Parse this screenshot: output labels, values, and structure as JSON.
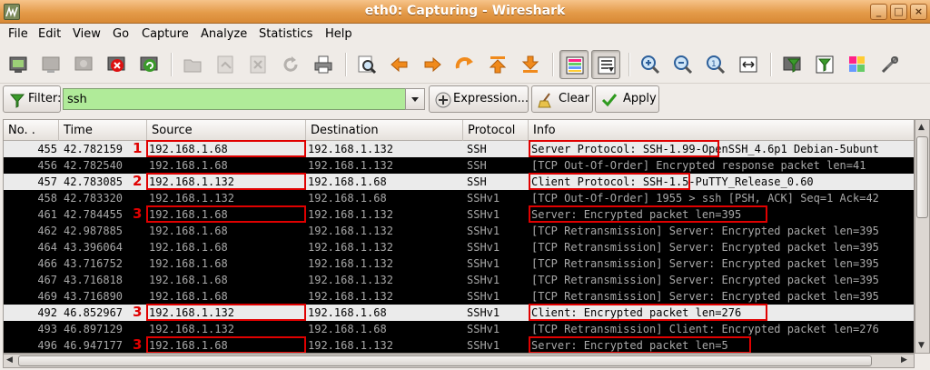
{
  "window": {
    "title": "eth0: Capturing - Wireshark",
    "minimize": "_",
    "maximize": "□",
    "close": "×"
  },
  "menu": [
    "File",
    "Edit",
    "View",
    "Go",
    "Capture",
    "Analyze",
    "Statistics",
    "Help"
  ],
  "toolbar_icons": [
    "interface-list-icon",
    "capture-options-icon",
    "start-capture-icon",
    "stop-capture-icon",
    "restart-capture-icon",
    "open-file-icon",
    "save-file-icon",
    "close-file-icon",
    "reload-icon",
    "print-icon",
    "find-packet-icon",
    "go-back-icon",
    "go-forward-icon",
    "go-to-packet-icon",
    "go-first-icon",
    "go-last-icon",
    "colorize-icon",
    "auto-scroll-icon",
    "zoom-in-icon",
    "zoom-out-icon",
    "zoom-normal-icon",
    "resize-columns-icon",
    "capture-filters-icon",
    "display-filters-icon",
    "coloring-rules-icon",
    "preferences-icon"
  ],
  "filter": {
    "label": "Filter:",
    "value": "ssh",
    "expression_label": "Expression...",
    "clear_label": "Clear",
    "apply_label": "Apply"
  },
  "columns": [
    "No. .",
    "Time",
    "Source",
    "Destination",
    "Protocol",
    "Info"
  ],
  "packets": [
    {
      "no": "455",
      "time": "42.782159",
      "src": "192.168.1.68",
      "dst": "192.168.1.132",
      "proto": "SSH",
      "info": "Server Protocol: SSH-1.99-OpenSSH_4.6p1 Debian-5ubunt",
      "style": "light"
    },
    {
      "no": "456",
      "time": "42.782540",
      "src": "192.168.1.68",
      "dst": "192.168.1.132",
      "proto": "SSH",
      "info": "[TCP Out-Of-Order] Encrypted response packet len=41",
      "style": "dark"
    },
    {
      "no": "457",
      "time": "42.783085",
      "src": "192.168.1.132",
      "dst": "192.168.1.68",
      "proto": "SSH",
      "info": "Client Protocol: SSH-1.5-PuTTY_Release_0.60",
      "style": "light"
    },
    {
      "no": "458",
      "time": "42.783320",
      "src": "192.168.1.132",
      "dst": "192.168.1.68",
      "proto": "SSHv1",
      "info": "[TCP Out-Of-Order] 1955 > ssh [PSH, ACK] Seq=1 Ack=42",
      "style": "dark"
    },
    {
      "no": "461",
      "time": "42.784455",
      "src": "192.168.1.68",
      "dst": "192.168.1.132",
      "proto": "SSHv1",
      "info": "Server: Encrypted packet len=395",
      "style": "dark"
    },
    {
      "no": "462",
      "time": "42.987885",
      "src": "192.168.1.68",
      "dst": "192.168.1.132",
      "proto": "SSHv1",
      "info": "[TCP Retransmission] Server: Encrypted packet len=395",
      "style": "dark"
    },
    {
      "no": "464",
      "time": "43.396064",
      "src": "192.168.1.68",
      "dst": "192.168.1.132",
      "proto": "SSHv1",
      "info": "[TCP Retransmission] Server: Encrypted packet len=395",
      "style": "dark"
    },
    {
      "no": "466",
      "time": "43.716752",
      "src": "192.168.1.68",
      "dst": "192.168.1.132",
      "proto": "SSHv1",
      "info": "[TCP Retransmission] Server: Encrypted packet len=395",
      "style": "dark"
    },
    {
      "no": "467",
      "time": "43.716818",
      "src": "192.168.1.68",
      "dst": "192.168.1.132",
      "proto": "SSHv1",
      "info": "[TCP Retransmission] Server: Encrypted packet len=395",
      "style": "dark"
    },
    {
      "no": "469",
      "time": "43.716890",
      "src": "192.168.1.68",
      "dst": "192.168.1.132",
      "proto": "SSHv1",
      "info": "[TCP Retransmission] Server: Encrypted packet len=395",
      "style": "dark"
    },
    {
      "no": "492",
      "time": "46.852967",
      "src": "192.168.1.132",
      "dst": "192.168.1.68",
      "proto": "SSHv1",
      "info": "Client: Encrypted packet len=276",
      "style": "light"
    },
    {
      "no": "493",
      "time": "46.897129",
      "src": "192.168.1.132",
      "dst": "192.168.1.68",
      "proto": "SSHv1",
      "info": "[TCP Retransmission] Client: Encrypted packet len=276",
      "style": "dark"
    },
    {
      "no": "496",
      "time": "46.947177",
      "src": "192.168.1.68",
      "dst": "192.168.1.132",
      "proto": "SSHv1",
      "info": "Server: Encrypted packet len=5",
      "style": "dark"
    }
  ],
  "annotations": [
    {
      "label": "1",
      "row": 0
    },
    {
      "label": "2",
      "row": 2
    },
    {
      "label": "3",
      "row": 4
    },
    {
      "label": "3",
      "row": 10
    },
    {
      "label": "3",
      "row": 12
    }
  ],
  "colors": {
    "filter_ok": "#b0eb99",
    "annotation": "#e00000",
    "title_bar": "#e49b4a"
  }
}
